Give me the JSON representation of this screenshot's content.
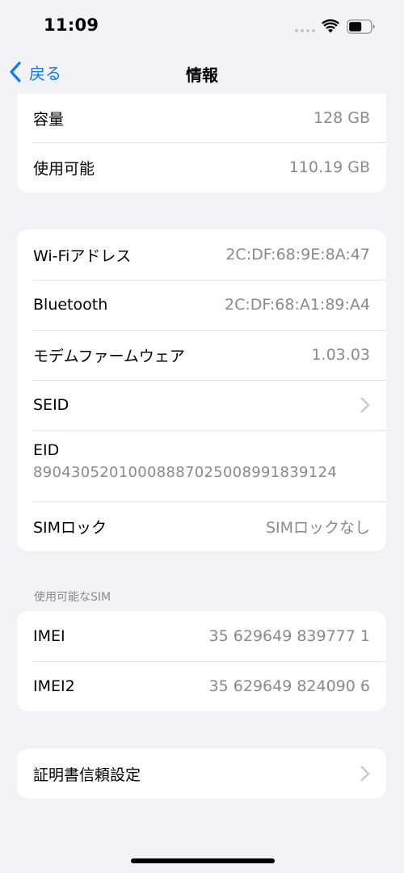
{
  "status_bar": {
    "time": "11:09",
    "icons": [
      "signal-dots-icon",
      "wifi-icon",
      "battery-icon"
    ]
  },
  "nav": {
    "back_label": "戻る",
    "title": "情報"
  },
  "storage": {
    "rows": [
      {
        "label": "容量",
        "value": "128 GB"
      },
      {
        "label": "使用可能",
        "value": "110.19 GB"
      }
    ]
  },
  "network": {
    "wifi_address": {
      "label": "Wi-Fiアドレス",
      "value": "2C:DF:68:9E:8A:47"
    },
    "bluetooth": {
      "label": "Bluetooth",
      "value": "2C:DF:68:A1:89:A4"
    },
    "modem_firmware": {
      "label": "モデムファームウェア",
      "value": "1.03.03"
    },
    "seid": {
      "label": "SEID"
    },
    "eid": {
      "label": "EID",
      "value": "89043052010008887025008991839124"
    },
    "sim_lock": {
      "label": "SIMロック",
      "value": "SIMロックなし"
    }
  },
  "sim": {
    "header": "使用可能なSIM",
    "imei": {
      "label": "IMEI",
      "value": "35 629649 839777 1"
    },
    "imei2": {
      "label": "IMEI2",
      "value": "35 629649 824090 6"
    }
  },
  "certificate": {
    "label": "証明書信頼設定"
  },
  "colors": {
    "accent": "#0a7aff",
    "background": "#f2f2f7",
    "secondary_text": "#8a8a8e"
  }
}
